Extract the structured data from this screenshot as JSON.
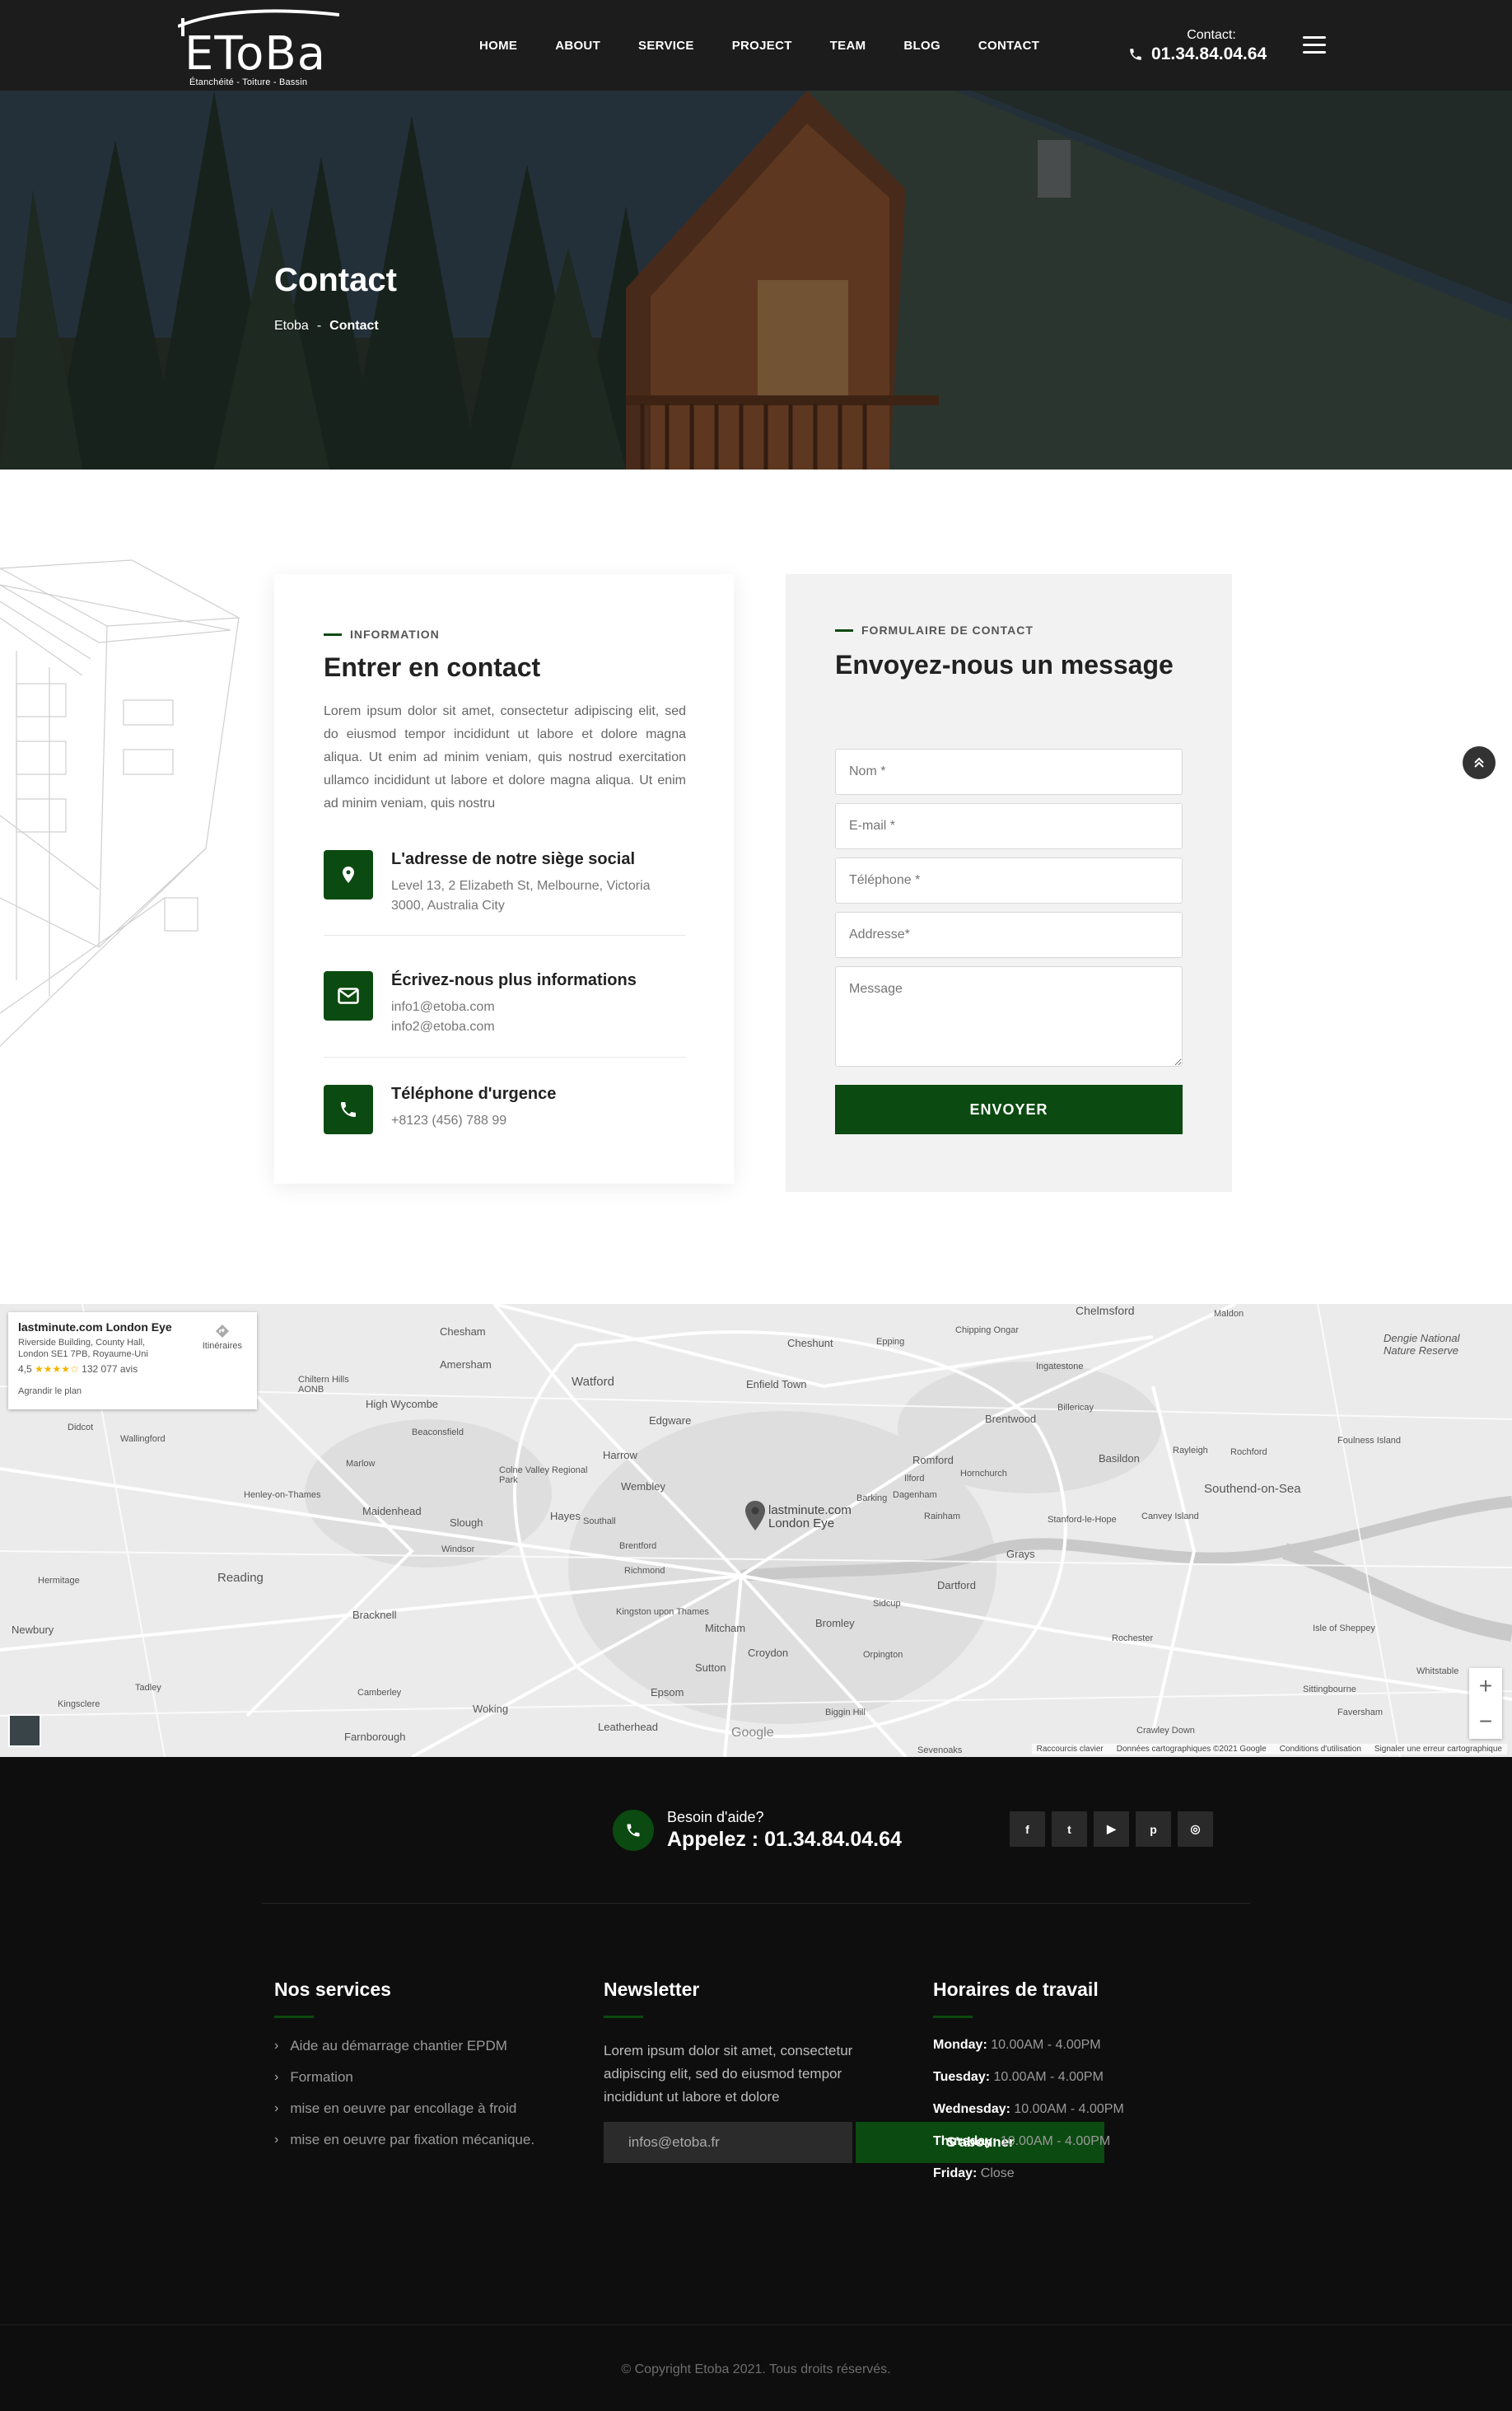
{
  "brand": {
    "logo_text": "EToBa",
    "logo_tagline": "Étanchéité - Toiture - Bassin"
  },
  "nav": {
    "items": [
      {
        "label": "HOME"
      },
      {
        "label": "ABOUT"
      },
      {
        "label": "SERVICE"
      },
      {
        "label": "PROJECT"
      },
      {
        "label": "TEAM"
      },
      {
        "label": "BLOG"
      },
      {
        "label": "CONTACT"
      }
    ]
  },
  "header_contact": {
    "label": "Contact:",
    "phone": "01.34.84.04.64",
    "icon": "phone-icon"
  },
  "hero": {
    "title": "Contact",
    "breadcrumb": {
      "home": "Etoba",
      "separator": "-",
      "current": "Contact"
    }
  },
  "info": {
    "eyebrow": "INFORMATION",
    "title": "Entrer en contact",
    "lead": "Lorem ipsum dolor sit amet, consectetur adipiscing elit, sed do eiusmod tempor incididunt ut labore et dolore magna aliqua. Ut enim ad minim veniam, quis nostrud exercitation ullamco incididunt ut labore et dolore magna aliqua. Ut enim ad minim veniam, quis nostru",
    "items": [
      {
        "icon": "map-pin-icon",
        "title": "L'adresse de notre siège social",
        "line1": "Level 13, 2 Elizabeth St, Melbourne, Victoria",
        "line2": "3000, Australia City"
      },
      {
        "icon": "envelope-icon",
        "title": "Écrivez-nous plus informations",
        "line1": "info1@etoba.com",
        "line2": "info2@etoba.com"
      },
      {
        "icon": "phone-ring-icon",
        "title": "Téléphone d'urgence",
        "line1": "+8123 (456) 788 99"
      }
    ]
  },
  "form": {
    "eyebrow": "FORMULAIRE DE CONTACT",
    "title": "Envoyez-nous un message",
    "fields": {
      "name": "Nom *",
      "email": "E-mail *",
      "phone": "Téléphone *",
      "address": "Addresse*",
      "message": "Message"
    },
    "submit": "ENVOYER"
  },
  "map": {
    "place": {
      "name": "lastminute.com London Eye",
      "address": "Riverside Building, County Hall, London SE1 7PB, Royaume-Uni",
      "rating": "4,5",
      "stars": "★★★★☆",
      "reviews": "132 077 avis",
      "enlarge": "Agrandir le plan",
      "directions": "Itinéraires"
    },
    "pin_label_1": "lastminute.com",
    "pin_label_2": "London Eye",
    "attribution": [
      "Raccourcis clavier",
      "Données cartographiques ©2021 Google",
      "Conditions d'utilisation",
      "Signaler une erreur cartographique"
    ],
    "google": "Google",
    "places": [
      "Chelmsford",
      "Chesham",
      "Amersham",
      "Watford",
      "Enfield Town",
      "Cheshunt",
      "Epping",
      "Chipping Ongar",
      "Ingatestone",
      "Billericay",
      "Basildon",
      "Romford",
      "Brentwood",
      "Southend-on-Sea",
      "High Wycombe",
      "Beaconsfield",
      "Harrow",
      "Wembley",
      "Edgware",
      "Marlow",
      "Maidenhead",
      "Slough",
      "Hayes",
      "Southall",
      "Ilford",
      "Barking",
      "Dagenham",
      "Rainham",
      "Stanford-le-Hope",
      "Canvey Island",
      "Reading",
      "Windsor",
      "Brentford",
      "Richmond",
      "Kingston upon Thames",
      "Mitcham",
      "Bromley",
      "Dartford",
      "Grays",
      "Croydon",
      "Sutton",
      "Epsom",
      "Bracknell",
      "Woking",
      "Farnborough",
      "Leatherhead",
      "Sevenoaks",
      "Rochester",
      "Rayleigh",
      "Rochford",
      "Foulness Island",
      "Hornchurch",
      "Isle of Sheppey",
      "Colne Valley Regional Park",
      "Chiltern Hills AONB",
      "Henley-on-Thames",
      "Wallingford",
      "Didcot",
      "Newbury",
      "Hermitage",
      "Kingsclere",
      "Orpington",
      "Sidcup",
      "Biggin Hill",
      "Tadley",
      "Camberley",
      "Crawley Down",
      "Faversham",
      "Whitstable",
      "Sittingbourne",
      "Maldon",
      "Dengie National Nature Reserve"
    ]
  },
  "footer": {
    "help_label": "Besoin d'aide?",
    "help_phone": "Appelez : 01.34.84.04.64",
    "social": [
      {
        "icon": "facebook-icon",
        "glyph": "f"
      },
      {
        "icon": "twitter-icon",
        "glyph": "t"
      },
      {
        "icon": "youtube-icon",
        "glyph": "▶"
      },
      {
        "icon": "pinterest-icon",
        "glyph": "p"
      },
      {
        "icon": "instagram-icon",
        "glyph": "◎"
      }
    ],
    "services": {
      "title": "Nos services",
      "items": [
        "Aide au démarrage chantier EPDM",
        "Formation",
        "mise en oeuvre par encollage à froid",
        "mise en oeuvre par fixation mécanique."
      ]
    },
    "newsletter": {
      "title": "Newsletter",
      "text": "Lorem ipsum dolor sit amet, consectetur adipiscing elit, sed do eiusmod tempor incididunt ut labore et dolore",
      "email_value": "infos@etoba.fr",
      "button": "S'abonner"
    },
    "hours": {
      "title": "Horaires de travail",
      "days": [
        {
          "day": "Monday:",
          "time": "10.00AM - 4.00PM"
        },
        {
          "day": "Tuesday:",
          "time": "10.00AM - 4.00PM"
        },
        {
          "day": "Wednesday:",
          "time": "10.00AM - 4.00PM"
        },
        {
          "day": "Thursday:",
          "time": "10.00AM - 4.00PM"
        },
        {
          "day": "Friday:",
          "time": "Close"
        }
      ]
    },
    "copyright": "© Copyright Etoba 2021. Tous droits réservés."
  },
  "colors": {
    "brand_green": "#0b4a10",
    "header_bg": "#1c1c1c",
    "footer_bg": "#0e0e0e"
  }
}
